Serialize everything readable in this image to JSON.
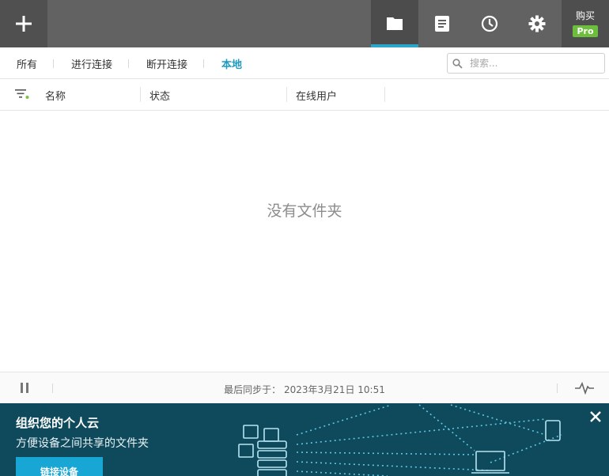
{
  "topbar": {
    "buy_label": "购买",
    "pro_badge": "Pro"
  },
  "tabs": [
    {
      "label": "所有",
      "active": false
    },
    {
      "label": "进行连接",
      "active": false
    },
    {
      "label": "断开连接",
      "active": false
    },
    {
      "label": "本地",
      "active": true
    }
  ],
  "search": {
    "placeholder": "搜索..."
  },
  "columns": {
    "name": "名称",
    "status": "状态",
    "online_users": "在线用户"
  },
  "empty_message": "没有文件夹",
  "statusbar": {
    "sync_label": "最后同步于：",
    "sync_time": "2023年3月21日 10:51"
  },
  "banner": {
    "title": "组织您的个人云",
    "subtitle": "方便设备之间共享的文件夹",
    "button": "链接设备"
  },
  "colors": {
    "accent": "#2aa6c9",
    "pro_green": "#6cbe3c",
    "banner_bg": "#0f4a5c",
    "banner_button": "#18a6d4"
  },
  "icons": [
    "plus-icon",
    "folder-icon",
    "log-icon",
    "clock-icon",
    "gear-icon",
    "search-icon",
    "filter-icon",
    "pause-icon",
    "pulse-icon",
    "close-icon"
  ]
}
